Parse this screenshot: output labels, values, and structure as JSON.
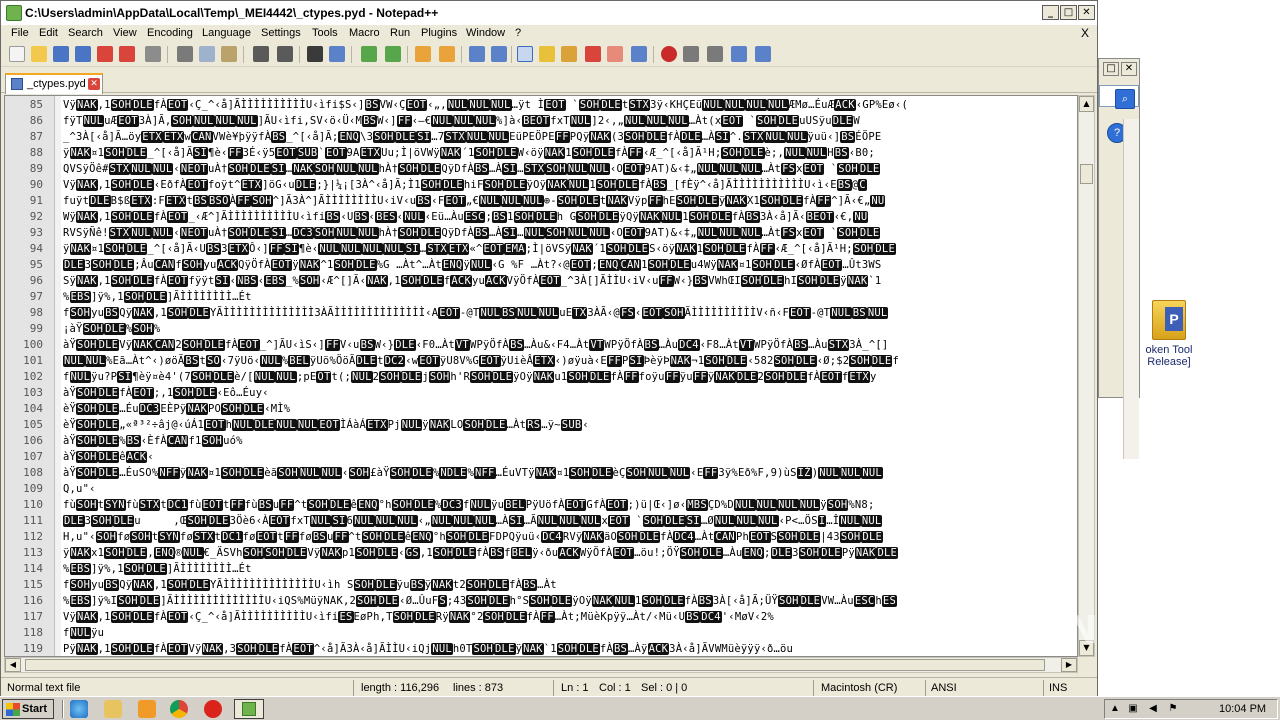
{
  "window": {
    "title": "C:\\Users\\admin\\AppData\\Local\\Temp\\_MEI4442\\_ctypes.pyd - Notepad++",
    "minimize": "_",
    "maximize": "□",
    "close": "✕"
  },
  "menu": {
    "items": [
      "File",
      "Edit",
      "Search",
      "View",
      "Encoding",
      "Language",
      "Settings",
      "Tools",
      "Macro",
      "Run",
      "Plugins",
      "Window",
      "?"
    ],
    "close_doc": "X"
  },
  "tab": {
    "label": "_ctypes.pyd",
    "close": "✕"
  },
  "editor": {
    "lines": [
      {
        "n": "85",
        "t": "Vÿ<b>NAK</b>,1<b>SOH</b><b>DLE</b>fÀ<b>EOT</b>‹Ç_^‹å]ÃÌÌÌÌÌÌÌÌÌÌU‹ìfi$S‹]<b>BS</b>VW‹Ç<b>EOT</b>‹„,<b>NUL</b><b>NUL</b><b>NUL</b>…ÿt Ì<b>EOT</b> `<b>SOH</b><b>DLE</b>t<b>STX</b>3ÿ‹KHÇEü<b>NUL</b><b>NUL</b><b>NUL</b><b>NUL</b>ÆMø…ÉuÆ<b>ACK</b>‹GP%Eø‹("
      },
      {
        "n": "86",
        "t": "fÿT<b>NUL</b>uÆ<b>EOT</b>3À]Ã,<b>SOH</b><b>NUL</b><b>NUL</b><b>NUL</b>]ÃU‹ìfi,SV‹ö‹Ü‹M<b>BS</b>W‹]<b>FF</b>‹–€<b>NUL</b><b>NUL</b><b>NUL</b>%]à‹<b>BEOT</b>fxT<b>NUL</b>]2‹,„<b>NUL</b><b>NUL</b><b>NUL</b>…Àt(x<b>EOT</b> `<b>SOH</b><b>DLE</b>uUSÿu<b>DLE</b>W"
      },
      {
        "n": "87",
        "t": "_^3À[‹å]Ã…öy<b>ETX</b><b>ETX</b>w<b>CAN</b>VWè¥þÿÿfÀ<b>BS</b>_^[‹å]Ã;<b>ENQ</b>\\3<b>SOH</b><b>DLE</b><b>SI</b>…7<b>STX</b><b>NUL</b><b>NUL</b>EüPEÖPE<b>FF</b>PQÿ<b>NAK</b>(3<b>SOH</b><b>DLE</b>fÀ<b>DLE</b>…À<b>SI</b>^.<b>STX</b><b>NUL</b><b>NUL</b>ÿuü‹]<b>BS</b>ÉÖPE"
      },
      {
        "n": "88",
        "t": "ÿ<b>NAK</b>¤1<b>SOH</b><b>DLE</b>_^[‹å]Ã<b>SI</b>¶è‹<b>FF</b>3É‹ÿ5<b>EOT</b><b>SUB</b>`<b>EOT</b>9A<b>ETX</b>Uu;Ì|öVWÿ<b>NAK</b>´1<b>SOH</b><b>DLE</b>W‹öÿ<b>NAK</b>1<b>SOH</b><b>DLE</b>fÀ<b>FF</b>‹Æ_^[‹å]Ã¹H;<b>SOH</b><b>DLE</b>è;,<b>NUL</b><b>NUL</b>H<b>BS</b>‹B0;"
      },
      {
        "n": "89",
        "t": "QVSÿÖê#<b>STX</b><b>NUL</b><b>NUL</b>‹<b>NEOT</b>uÀ†<b>SOH</b><b>DLE</b><b>SI</b>…<b>NAK</b><b>SOH</b><b>NUL</b><b>NUL</b>hÀ†<b>SOH</b><b>DLE</b>QÿDfÀ<b>BS</b>…À<b>SI</b>…<b>STX</b><b>SOH</b><b>NUL</b><b>NUL</b>‹O<b>EOT</b>9AT)&‹‡„<b>NUL</b><b>NUL</b><b>NUL</b>…Àt<b>FS</b>x<b>EOT</b> `<b>SOH</b><b>DLE</b>"
      },
      {
        "n": "90",
        "t": "Vÿ<b>NAK</b>,1<b>SOH</b><b>DLE</b>‹EðfÀ<b>EOT</b>foÿt^<b>ETX</b>]öG‹u<b>DLE</b>;}|¼¡[3À^‹å]Ã;Ì1<b>SOH</b><b>DLE</b>hiF<b>SOH</b><b>DLE</b>ÿOÿ<b>NAK</b><b>NUL</b>1<b>SOH</b><b>DLE</b>fÀ<b>BS</b>_[fÈÿ^‹å]ÃÌÌÌÌÌÌÌÌÌÌÌU‹ì‹E<b>BS</b>@<b>C</b>"
      },
      {
        "n": "91",
        "t": "fuÿt<b>DLE</b>B$ß<b>ETX</b>:F<b>ETX</b>t<b>BS</b><b>BSO</b>À<b>FF</b><b>SOH</b>^]Ã3À^]ÃÌÌÌÌÌÌÌÌU‹iV‹u<b>BS</b>‹F<b>EOT</b>„€<b>NUL</b><b>NUL</b><b>NUL</b>⊕-<b>SOH</b><b>DLE</b>t<b>NAK</b>Vÿp<b>FF</b>hE<b>SOH</b><b>DLE</b>ÿ<b>NAK</b>X1<b>SOH</b><b>DLE</b>fÀ<b>FF</b>^]Ã‹€„<b>NU</b>"
      },
      {
        "n": "92",
        "t": "Wÿ<b>NAK</b>,1<b>SOH</b><b>DLE</b>fÀ<b>EOT</b>_‹Æ^]ÃÌÌÌÌÌÌÌÌÌÌU‹ìfi<b>BS</b>‹U<b>BS</b>‹<b>BES</b>‹<b>NUL</b>‹Eü…Àu<b>ESC</b>;<b>BS</b>1<b>SOH</b><b>DLE</b>h G<b>SOH</b><b>DLE</b>ÿQÿ<b>NAK</b><b>NUL</b>1<b>SOH</b><b>DLE</b>fÀ<b>BS</b>3À‹å]Ã‹<b>BEOT</b>‹€,<b>NU</b>"
      },
      {
        "n": "93",
        "t": "RVSÿÑê!<b>STX</b><b>NUL</b><b>NUL</b>‹<b>NEOT</b>uÀ†<b>SOH</b><b>DLE</b><b>SI</b>…<b>DC3</b><b>SOH</b><b>NUL</b><b>NUL</b>hÀ†<b>SOH</b><b>DLE</b>QÿDfÀ<b>BS</b>…À<b>SI</b>…<b>NUL</b><b>SOH</b><b>NUL</b><b>NUL</b>‹O<b>EOT</b>9AT)&‹‡„<b>NUL</b><b>NUL</b><b>NUL</b>…Àt<b>FS</b>x<b>EOT</b> `<b>SOH</b><b>DLE</b>"
      },
      {
        "n": "94",
        "t": "ÿ<b>NAK</b>¤1<b>SOH</b><b>DLE</b>_^[‹å]Ã‹U<b>BS</b>3<b>ETX</b>Ô‹]<b>FF</b><b>SI</b>¶è‹<b>NUL</b><b>NUL</b><b>NUL</b><b>NUL</b><b>SI</b>…<b>STX</b><b>ETX</b>«^<b>EOT</b><b>EMA</b>;Ì|öVSÿ<b>NAK</b>´1<b>SOH</b><b>DLE</b>S‹öÿ<b>NAK</b>1<b>SOH</b><b>DLE</b>fÀ<b>FF</b>‹Æ_^[‹å]Ã¹H;<b>SOH</b><b>DLE</b>"
      },
      {
        "n": "95",
        "t": "<b>DLE</b>3<b>SOH</b><b>DLE</b>;Âu<b>CAN</b>f<b>SOH</b>yu<b>ACK</b>QÿÖfÀ<b>EOT</b>ÿ<b>NAK</b>^1<b>SOH</b><b>DLE</b>%G …Àt^…Àt<b>ENQ</b>ÿ<b>NUL</b>‹G %F …Àt?‹@<b>EOT</b>;<b>ENQ</b><b>CAN</b>1<b>SOH</b><b>DLE</b>u4Wÿ<b>NAK</b>¤1<b>SOH</b><b>DLE</b>‹ØfÀ<b>EOT</b>…Ût3WS"
      },
      {
        "n": "96",
        "t": "Sÿ<b>NAK</b>,1<b>SOH</b><b>DLE</b>fÀ<b>EOT</b>fÿÿt<b>SI</b>‹<b>NBS</b>‹<b>EBS</b>_%<b>SOH</b>‹Æ^[]Ã‹<b>NAK</b>,1<b>SOH</b><b>DLE</b>f<b>ACK</b>yu<b>ACK</b>VÿÖfÀ<b>EOT</b>_^3À[]ÃÌÌU‹iV‹u<b>FF</b>W‹}<b>BS</b>VWhŒI<b>SOH</b><b>DLE</b>hI<b>SOH</b><b>DLE</b>ÿ<b>NAK</b>`1"
      },
      {
        "n": "97",
        "t": "%<b>EBS</b>]ÿ%,1<b>SOH</b><b>DLE</b>]ÃÌÌÌÌÌÌÌÌ…Ét"
      },
      {
        "n": "98",
        "t": "f<b>SOH</b>yu<b>BS</b>Qÿ<b>NAK</b>,1<b>SOH</b><b>DLE</b>YÃÌÌÌÌÌÌÌÌÌÌÌÌÌÌ3ÀÃÌÌÌÌÌÌÌÌÌÌÌÌÌÌ‹A<b>EOT</b>-@T<b>NUL</b><b>BS</b><b>NUL</b><b>NUL</b>uE<b>TX</b>3ÀÃ‹@<b>FS</b>‹<b>EOT</b><b>SOH</b>ÃÌÌÌÌÌÌÌÌÌÌV‹ñ‹F<b>EOT</b>-@T<b>NUL</b><b>BS</b><b>NUL</b>"
      },
      {
        "n": "99",
        "t": "¡àŸ<b>SOH</b><b>DLE</b>%<b>SOH</b>%"
      },
      {
        "n": "100",
        "t": "àŸ<b>SOH</b><b>DLE</b>Vÿ<b>NAK</b><b>CAN</b>2<b>SOH</b><b>DLE</b>fÀ<b>EOT</b>_^]ÃU‹ìS‹]<b>FF</b>V‹u<b>BS</b>W‹}<b>DLE</b>‹F0…Àt<b>VT</b>WPÿÖfÀ<b>BS</b>…Àu&‹F4…Àt<b>VT</b>WPÿÖfÀ<b>BS</b>…Àu<b>DC4</b>‹F8…Àt<b>VT</b>WPÿÖfÀ<b>BS</b>…Àu<b>STX</b>3À_^[]"
      },
      {
        "n": "101",
        "t": "<b>NUL</b><b>NUL</b>%Eã…Àt^‹)øöÃ<b>BS</b>t<b>SO</b>‹7ÿUö‹<b>NUL</b>%<b>BEL</b>ÿUö%ÖöÃ<b>DLE</b>t<b>DC2</b>‹w<b>EOT</b>ÿU8V%G<b>EOT</b>ÿUièÂ<b>ETX</b>‹)øÿuà‹E<b>FF</b>P<b>SI</b>ÞèÿÞ<b>NAK</b>¬1<b>SOH</b><b>DLE</b>‹582<b>SOH</b><b>DLE</b>‹Ø;$2<b>SOH</b><b>DLE</b>f"
      },
      {
        "n": "102",
        "t": "f<b>NUL</b>ÿu?P<b>SI</b>¶èÿ¤è4'(7<b>SOH</b><b>DLE</b>è/[<b>NUL</b><b>NUL</b>;pE<b>OT</b>t(;<b>NUL</b>2<b>SOH</b><b>DLE</b>j<b>SOH</b>h'R<b>SOH</b><b>DLE</b>ÿOÿ<b>NAK</b>u1<b>SOH</b><b>DLE</b>fÀ<b>FF</b>foÿu<b>FF</b>ÿu<b>FF</b>ÿ<b>NAK</b><b>DLE</b>2<b>SOH</b><b>DLE</b>fÀ<b>EOT</b>f<b>ETX</b>y"
      },
      {
        "n": "103",
        "t": "àŸ<b>SOH</b><b>DLE</b>fÀ<b>EOT</b>;,1<b>SOH</b><b>DLE</b>‹Eô…Éuy‹"
      },
      {
        "n": "104",
        "t": "èŸ<b>SOH</b><b>DLE</b>…Éu<b>DC3</b>EÈPÿ<b>NAK</b>PO<b>SOH</b><b>DLE</b>‹MÌ%"
      },
      {
        "n": "105",
        "t": "èŸ<b>SOH</b><b>DLE</b>„«ª³²÷âj@‹úÁ1<b>EOT</b>h<b>NUL</b><b>DLE</b><b>NUL</b><b>NUL</b><b>EOT</b>ÌÁàÁ<b>ETX</b>Pj<b>NUL</b>ÿ<b>NAK</b>LO<b>SOH</b><b>DLE</b>…Àt<b>RS</b>…ÿ~<b>SUB</b>‹"
      },
      {
        "n": "106",
        "t": "àŸ<b>SOH</b><b>DLE</b>%<b>BS</b>‹ÈfÀ<b>CAN</b>f1<b>SOH</b>uó%"
      },
      {
        "n": "107",
        "t": "àŸ<b>SOH</b><b>DLE</b>ê<b>ACK</b>‹"
      },
      {
        "n": "108",
        "t": "àŸ<b>SOH</b><b>DLE</b>…ÉuSO%<b>NFF</b>ÿ<b>NAK</b>¤1<b>SOH</b><b>DLE</b>èã<b>SOH</b><b>NUL</b><b>NUL</b>‹<b>SOH</b>£àŸ<b>SOH</b><b>DLE</b>%<b>NDLE</b>%<b>NFF</b>…ÉuVTÿ<b>NAK</b>¤1<b>SOH</b><b>DLE</b>èÇ<b>SOH</b><b>NUL</b><b>NUL</b>‹E<b>FF</b>3ÿ%Eð%F,9)ùS<b>IŽ</b>)<b>NUL</b><b>NUL</b><b>NUL</b>"
      },
      {
        "n": "109",
        "t": "Q,u\"‹"
      },
      {
        "n": "110",
        "t": "fù<b>SOH</b>t<b>SYN</b>fù<b>STX</b>t<b>DC1</b>fù<b>EOT</b>t<b>FF</b>fù<b>BS</b>u<b>FF</b>^t<b>SOH</b><b>DLE</b>ê<b>ENQ</b>°h<b>SOH</b><b>DLE</b>%<b>DC3</b>f<b>NUL</b>ÿu<b>BEL</b>PÿUöfÀ<b>EOT</b>GfÀ<b>EOT</b>;)ü|Œ‹]ø‹<b>MBS</b>ÇD%D<b>NUL</b><b>NUL</b><b>NUL</b><b>NUL</b>ÿ<b>SOH</b>%N8;"
      },
      {
        "n": "111",
        "t": "<b>DLE</b>3<b>SOH</b><b>DLE</b>u     ,Œ<b>SOH</b><b>DLE</b>3Öè6‹À<b>EOT</b>fxT<b>NUL</b><b>SI</b>6<b>NUL</b><b>NUL</b><b>NUL</b>‹„<b>NUL</b><b>NUL</b><b>NUL</b>…À<b>SI</b>…Ã<b>NUL</b><b>NUL</b><b>NUL</b>x<b>EOT</b> `<b>SOH</b><b>DLE</b><b>SI</b>…Ø<b>NUL</b><b>NUL</b><b>NUL</b>‹P<…ÖS<b>I</b>…Î<b>NUL</b><b>NUL</b>"
      },
      {
        "n": "112",
        "t": "H,u\"‹<b>SOH</b>fø<b>SOH</b>t<b>SYN</b>fø<b>STX</b>t<b>DC1</b>fø<b>EOT</b>t<b>FF</b>fø<b>BS</b>u<b>FF</b>^t<b>SOH</b><b>DLE</b>ê<b>ENQ</b>°h<b>SOH</b><b>DLE</b>FDPQÿuü‹<b>DC4</b>RVÿ<b>NAK</b>äO<b>SOH</b><b>DLE</b>fÀ<b>DC4</b>…Àt<b>CAN</b>Ph<b>EOT</b>S<b>SOH</b><b>DLE</b>|43<b>SOH</b><b>DLE</b>"
      },
      {
        "n": "113",
        "t": "ÿ<b>NAK</b>x1<b>SOH</b><b>DLE</b>,<b>ENQ</b>®<b>NUL</b>€_ÄSVh<b>SOH</b><b>SOH</b><b>DLE</b>Vÿ<b>NAK</b>p1<b>SOH</b><b>DLE</b>‹<b>GS</b>,1<b>SOH</b><b>DLE</b>fÀ<b>BS</b>f<b>BEL</b>ÿ‹ðu<b>ACK</b>WÿÖfÀ<b>EOT</b>…öu!;ÖŸ<b>SOH</b><b>DLE</b>…Àu<b>ENQ</b>;<b>DLE</b>3<b>SOH</b><b>DLE</b>Pÿ<b>NAK</b><b>DLE</b>"
      },
      {
        "n": "114",
        "t": "%<b>EBS</b>]ÿ%,1<b>SOH</b><b>DLE</b>]ÃÌÌÌÌÌÌÌÌ…Ét"
      },
      {
        "n": "115",
        "t": "f<b>SOH</b>yu<b>BS</b>Qÿ<b>NAK</b>,1<b>SOH</b><b>DLE</b>YÃÌÌÌÌÌÌÌÌÌÌÌÌÌÌU‹ìh S<b>SOH</b><b>DLE</b>ÿu<b>BS</b>ÿ<b>NAK</b>t2<b>SOH</b><b>DLE</b>fÀ<b>BS</b>…Àt"
      },
      {
        "n": "116",
        "t": "%<b>EBS</b>]ÿ%I<b>SOH</b><b>DLE</b>]ÃÌÌÌÌÌÌÌÌÌÌÌÌÌÌU‹iQS%MüÿNAK,2<b>SOH</b><b>DLE</b>‹Ø…ÛuF<b>S</b>;43<b>SOH</b><b>DLE</b>h°S<b>SOH</b><b>DLE</b>ÿOÿ<b>NAK</b><b>NUL</b>1<b>SOH</b><b>DLE</b>fÀ<b>BS</b>3À[‹å]Ã;ÜŸ<b>SOH</b><b>DLE</b>VW…Àu<b>ESC</b>h<b>ES</b>"
      },
      {
        "n": "117",
        "t": "Vÿ<b>NAK</b>,1<b>SOH</b><b>DLE</b>fÀ<b>EOT</b>‹Ç_^‹å]ÃÌÌÌÌÌÌÌÌÌÌU‹ìfi<b>ES</b>EøPh,T<b>SOH</b><b>DLE</b>Rÿ<b>NAK</b>°2<b>SOH</b><b>DLE</b>fÀ<b>FF</b>…Àt;MüèKpÿÿ…Àt/‹Mü‹U<b>BS</b><b>DC4</b>'‹MøV‹2%"
      },
      {
        "n": "118",
        "t": "f<b>NUL</b>ÿu"
      },
      {
        "n": "119",
        "t": "Pÿ<b>NAK</b>,1<b>SOH</b><b>DLE</b>fÀ<b>EOT</b>Vÿ<b>NAK</b>,3<b>SOH</b><b>DLE</b>fÀ<b>EOT</b>^‹å]Ã3À‹å]ÃÌÌU‹iQj<b>NUL</b>h0T<b>SOH</b><b>DLE</b>ÿ<b>NAK</b>`1<b>SOH</b><b>DLE</b>fÀ<b>BS</b>…Àÿ<b>ACK</b>3À‹å]ÃVWMüèÿÿÿ‹ð…öu"
      }
    ]
  },
  "status": {
    "type": "Normal text file",
    "length": "length : 116,296",
    "lines": "lines : 873",
    "ln": "Ln : 1",
    "col": "Col : 1",
    "sel": "Sel : 0 | 0",
    "eol": "Macintosh (CR)",
    "encoding": "ANSI",
    "mode": "INS"
  },
  "taskbar": {
    "start": "Start",
    "clock": "10:04 PM"
  },
  "desktop": {
    "icon_label": "oken Tool Release]"
  },
  "watermark": "ANY RUN"
}
